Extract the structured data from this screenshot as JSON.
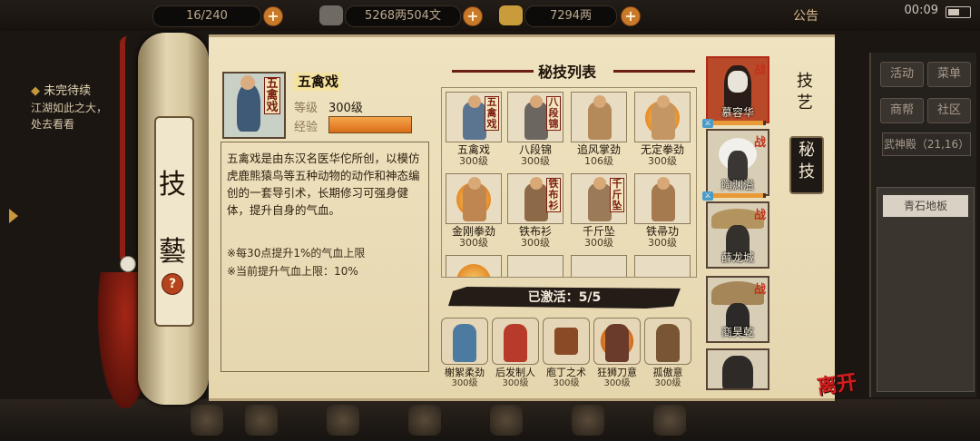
{
  "hud": {
    "energy": "16/240",
    "silver_currency": "5268两504文",
    "gold_currency": "7294两",
    "notice": "公告",
    "time": "00:09"
  },
  "quest": {
    "title": "未完待续",
    "line1": "江湖如此之大，",
    "line2": "处去看看"
  },
  "scroll": {
    "char_top": "技",
    "char_bottom": "藝",
    "help": "?"
  },
  "skill": {
    "name": "五禽戏",
    "label_short": "五禽戏",
    "level_label": "等级",
    "level_value": "300级",
    "exp_label": "经验",
    "exp_fraction": 1.0,
    "description": "五禽戏是由东汉名医华佗所创，以模仿虎鹿熊猿鸟等五种动物的动作和神态编创的一套导引术，长期修习可强身健体，提升自身的气血。",
    "note1": "※每30点提升1%的气血上限",
    "note2": "※当前提升气血上限：10%"
  },
  "list": {
    "title": "秘技列表",
    "items": [
      {
        "name": "五禽戏",
        "level": "300级",
        "tag": "五禽戏"
      },
      {
        "name": "八段锦",
        "level": "300级",
        "tag": "八段锦"
      },
      {
        "name": "追风掌劲",
        "level": "106级",
        "tag": ""
      },
      {
        "name": "无定拳劲",
        "level": "300级",
        "tag": ""
      },
      {
        "name": "金刚拳劲",
        "level": "300级",
        "tag": ""
      },
      {
        "name": "铁布衫",
        "level": "300级",
        "tag": "铁布衫"
      },
      {
        "name": "千斤坠",
        "level": "300级",
        "tag": "千斤坠"
      },
      {
        "name": "铁帚功",
        "level": "300级",
        "tag": ""
      }
    ],
    "active_label": "已激活：5/5",
    "active": [
      {
        "name": "榭絮柔劲",
        "level": "300级"
      },
      {
        "name": "后发制人",
        "level": "300级"
      },
      {
        "name": "庖丁之术",
        "level": "300级"
      },
      {
        "name": "狂狮刀意",
        "level": "300级"
      },
      {
        "name": "孤傲意",
        "level": "300级"
      }
    ]
  },
  "characters": {
    "battle_mark": "战",
    "items": [
      {
        "name": "慕容华"
      },
      {
        "name": "陶渊溢"
      },
      {
        "name": "薛龙城"
      },
      {
        "name": "商昊乾"
      },
      {
        "name": ""
      }
    ]
  },
  "tabs": {
    "craft": "技艺",
    "secret": "秘技"
  },
  "right_panel": {
    "btn_activity": "活动",
    "btn_menu": "菜单",
    "btn_guild": "商帮",
    "btn_community": "社区",
    "location": "武神殿（21,16）",
    "ground": "青石地板"
  },
  "leave": "离开"
}
